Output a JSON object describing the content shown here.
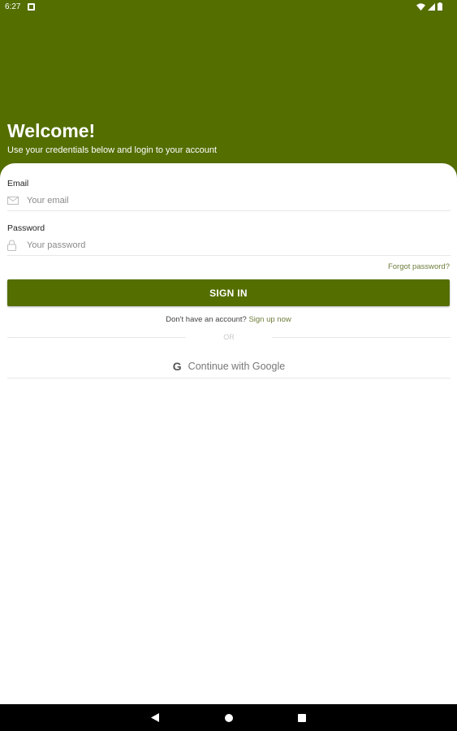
{
  "status_bar": {
    "time": "6:27"
  },
  "header": {
    "title": "Welcome!",
    "subtitle": "Use your credentials below and login to your account"
  },
  "form": {
    "email_label": "Email",
    "email_placeholder": "Your email",
    "email_value": "",
    "password_label": "Password",
    "password_placeholder": "Your password",
    "password_value": "",
    "forgot_password": "Forgot password?",
    "sign_in_label": "SIGN IN",
    "no_account_text": "Don't have an account?",
    "sign_up_link": "Sign up now",
    "or_text": "OR",
    "google_g": "G",
    "google_label": "Continue with Google"
  },
  "colors": {
    "primary": "#546e00",
    "link": "#6d7d3a",
    "divider": "#e8e8e8"
  },
  "icons": [
    "notification-icon",
    "wifi-icon",
    "signal-icon",
    "battery-icon",
    "email-icon",
    "lock-icon",
    "google-icon",
    "back-icon",
    "home-icon",
    "recents-icon"
  ]
}
